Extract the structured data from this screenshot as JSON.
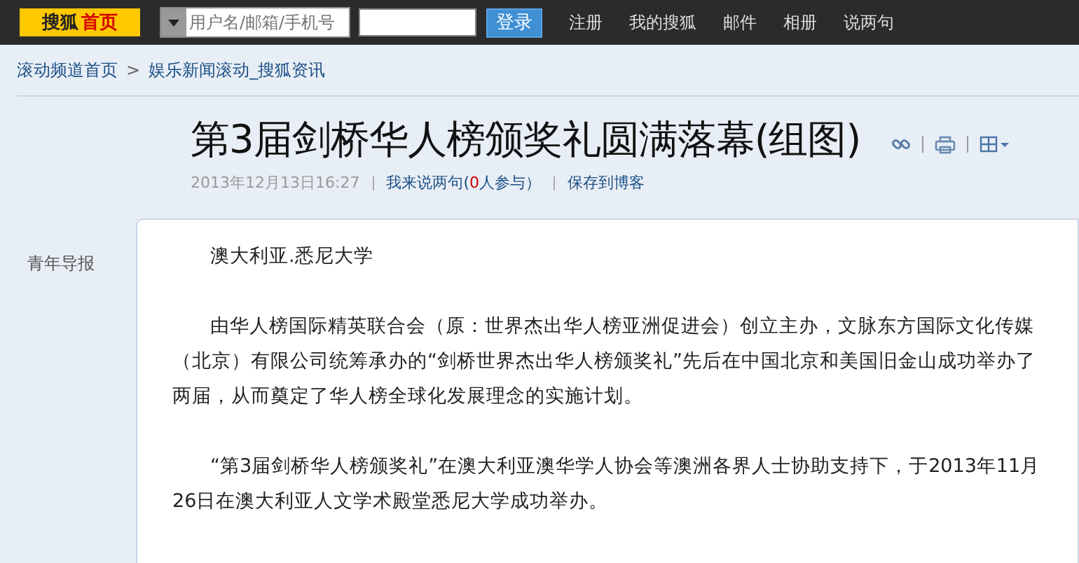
{
  "topbar": {
    "logo": {
      "brand": "搜狐",
      "home": "首页"
    },
    "username": {
      "placeholder": "用户名/邮箱/手机号"
    },
    "login_button": "登录",
    "links": [
      "注册",
      "我的搜狐",
      "邮件",
      "相册",
      "说两句"
    ]
  },
  "breadcrumb": {
    "items": [
      "滚动频道首页",
      "娱乐新闻滚动_搜狐资讯"
    ],
    "separator": ">"
  },
  "article": {
    "title": "第3届剑桥华人榜颁奖礼圆满落幕(组图)",
    "date": "2013年12月13日16:27",
    "comment_link": "我来说两句",
    "comment_count": "0",
    "comment_suffix": "人参与）",
    "comment_prefix": "(",
    "save_link": "保存到博客",
    "source": "青年导报",
    "paragraphs": [
      "澳大利亚.悉尼大学",
      "由华人榜国际精英联合会（原：世界杰出华人榜亚洲促进会）创立主办，文脉东方国际文化传媒（北京）有限公司统筹承办的“剑桥世界杰出华人榜颁奖礼”先后在中国北京和美国旧金山成功举办了两届，从而奠定了华人榜全球化发展理念的实施计划。",
      "“第3届剑桥华人榜颁奖礼”在澳大利亚澳华学人协会等澳洲各界人士协助支持下，于2013年11月26日在澳大利亚人文学术殿堂悉尼大学成功举办。"
    ]
  }
}
